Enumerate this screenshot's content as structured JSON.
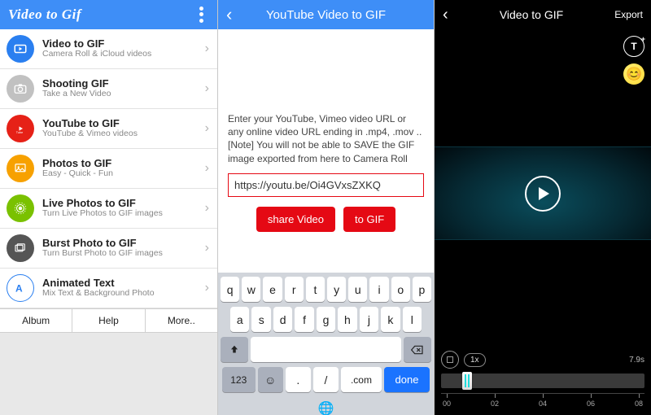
{
  "panel1": {
    "header_title": "Video to Gif",
    "items": [
      {
        "title": "Video to GIF",
        "subtitle": "Camera Roll & iCloud videos",
        "iconColor": "#2a7ff0",
        "icon": "play-icon"
      },
      {
        "title": "Shooting GIF",
        "subtitle": "Take a New Video",
        "iconColor": "#c1c1c1",
        "icon": "camera-icon"
      },
      {
        "title": "YouTube to GIF",
        "subtitle": "YouTube & Vimeo videos",
        "iconColor": "#e62117",
        "icon": "youtube-icon"
      },
      {
        "title": "Photos to GIF",
        "subtitle": "Easy - Quick - Fun",
        "iconColor": "#f7a100",
        "icon": "photo-icon"
      },
      {
        "title": "Live Photos to GIF",
        "subtitle": "Turn Live Photos to GIF images",
        "iconColor": "#7ac100",
        "icon": "livephoto-icon"
      },
      {
        "title": "Burst Photo to GIF",
        "subtitle": "Turn Burst Photo to GIF images",
        "iconColor": "#555555",
        "icon": "burst-icon"
      },
      {
        "title": "Animated Text",
        "subtitle": "Mix Text & Background Photo",
        "iconColor": "#2a7ff0",
        "icon": "text-icon"
      }
    ],
    "footer": {
      "album": "Album",
      "help": "Help",
      "more": "More.."
    }
  },
  "panel2": {
    "header_title": "YouTube Video to GIF",
    "info_text": "Enter your YouTube, Vimeo video URL or any online video URL ending in .mp4, .mov .. [Note] You will not be able to SAVE the GIF image exported from here to Camera Roll",
    "url_value": "https://youtu.be/Oi4GVxsZXKQ",
    "share_label": "share Video",
    "togif_label": "to GIF",
    "keyboard": {
      "row1": [
        "q",
        "w",
        "e",
        "r",
        "t",
        "y",
        "u",
        "i",
        "o",
        "p"
      ],
      "row2": [
        "a",
        "s",
        "d",
        "f",
        "g",
        "h",
        "j",
        "k",
        "l"
      ],
      "row4": {
        "num": "123",
        "dot": ".",
        "slash": "/",
        "com": ".com",
        "done": "done"
      }
    }
  },
  "panel3": {
    "header_title": "Video to GIF",
    "export_label": "Export",
    "speed_label": "1x",
    "duration_label": "7.9s",
    "ruler": [
      "00",
      "02",
      "04",
      "06",
      "08"
    ]
  }
}
